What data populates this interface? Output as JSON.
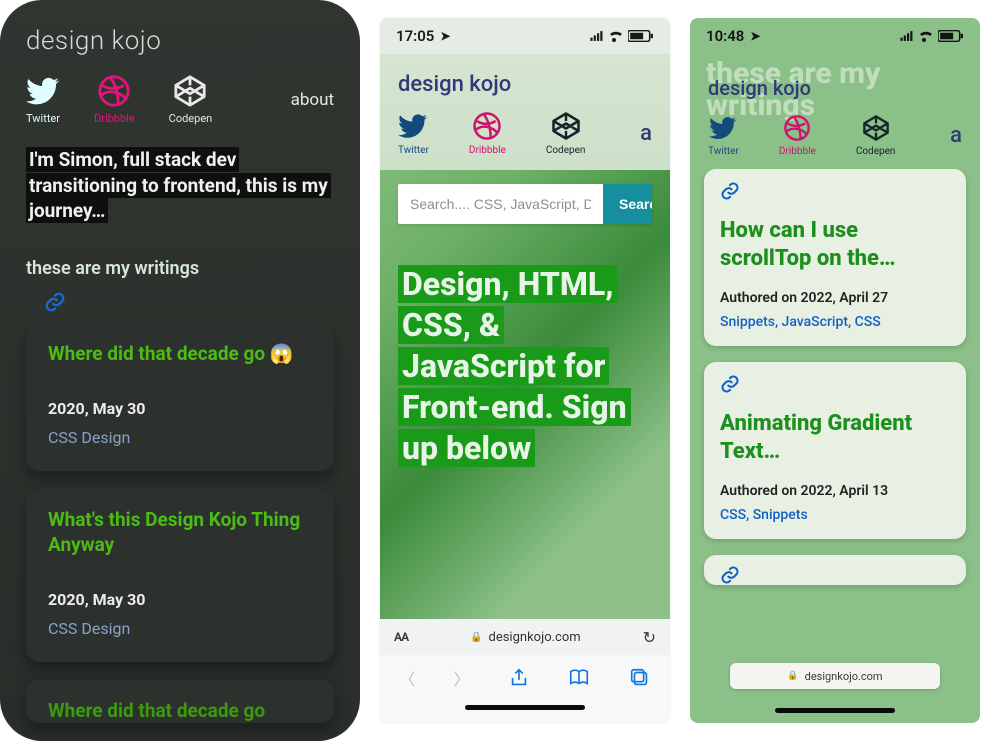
{
  "dark": {
    "brand": "design kojo",
    "socials": {
      "twitter": "Twitter",
      "dribbble": "Dribbble",
      "codepen": "Codepen"
    },
    "about": "about",
    "intro": "I'm Simon,  full stack dev transitioning to frontend, this is my journey…",
    "writings_heading": "these are my writings",
    "cards": [
      {
        "title": "Where did that decade go 😱",
        "date": "2020, May 30",
        "tags": "CSS Design"
      },
      {
        "title": "What's this Design Kojo Thing Anyway",
        "date": "2020, May 30",
        "tags": "CSS Design"
      },
      {
        "title": "Where did that decade go"
      }
    ]
  },
  "mid": {
    "status_time": "17:05",
    "brand": "design kojo",
    "socials": {
      "twitter": "Twitter",
      "dribbble": "Dribbble",
      "codepen": "Codepen"
    },
    "overflow": "a",
    "search_placeholder": "Search.... CSS, JavaScript, D",
    "search_button": "Search",
    "hero": "Design, HTML, CSS, & JavaScript for Front-end. Sign up below",
    "url_aa": "AA",
    "url_domain": "designkojo.com"
  },
  "right": {
    "status_time": "10:48",
    "back_title": "these are my writings",
    "brand": "design kojo",
    "socials": {
      "twitter": "Twitter",
      "dribbble": "Dribbble",
      "codepen": "Codepen"
    },
    "overflow": "a",
    "cards": [
      {
        "title": "How can I use scrollTop on the…",
        "authored": "Authored on 2022, April 27",
        "tags": "Snippets, JavaScript, CSS"
      },
      {
        "title": "Animating Gradient Text…",
        "authored": "Authored on 2022, April 13",
        "tags": "CSS, Snippets"
      }
    ],
    "url_domain": "designkojo.com"
  }
}
